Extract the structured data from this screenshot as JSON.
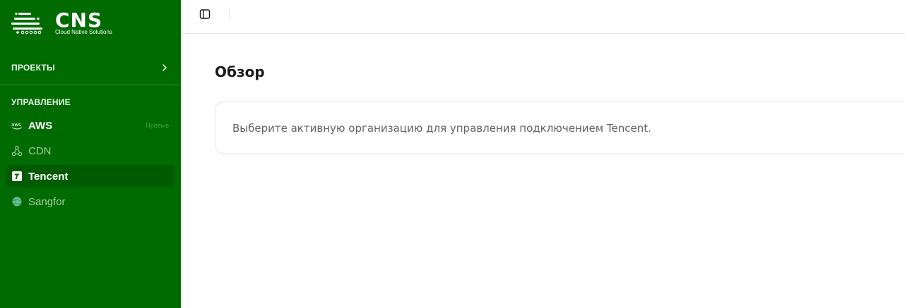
{
  "brand": {
    "name": "CNS",
    "tagline": "Cloud Native Solutions"
  },
  "sidebar": {
    "projects_label": "ПРОЕКТЫ",
    "management_label": "УПРАВЛЕНИЕ",
    "items": [
      {
        "label": "AWS",
        "icon": "aws-icon",
        "badge": "Превью",
        "active": false
      },
      {
        "label": "CDN",
        "icon": "network-icon",
        "active": false
      },
      {
        "label": "Tencent",
        "icon": "tencent-icon",
        "active": true
      },
      {
        "label": "Sangfor",
        "icon": "globe-icon",
        "active": false
      }
    ]
  },
  "topbar": {
    "toggle_icon": "sidebar-toggle-icon"
  },
  "main": {
    "title": "Обзор",
    "message": "Выберите активную организацию для управления подключением Tencent."
  },
  "colors": {
    "sidebar_bg": "#006b00",
    "active_item_bg": "#005a00",
    "dim_text": "#9fd09f"
  }
}
